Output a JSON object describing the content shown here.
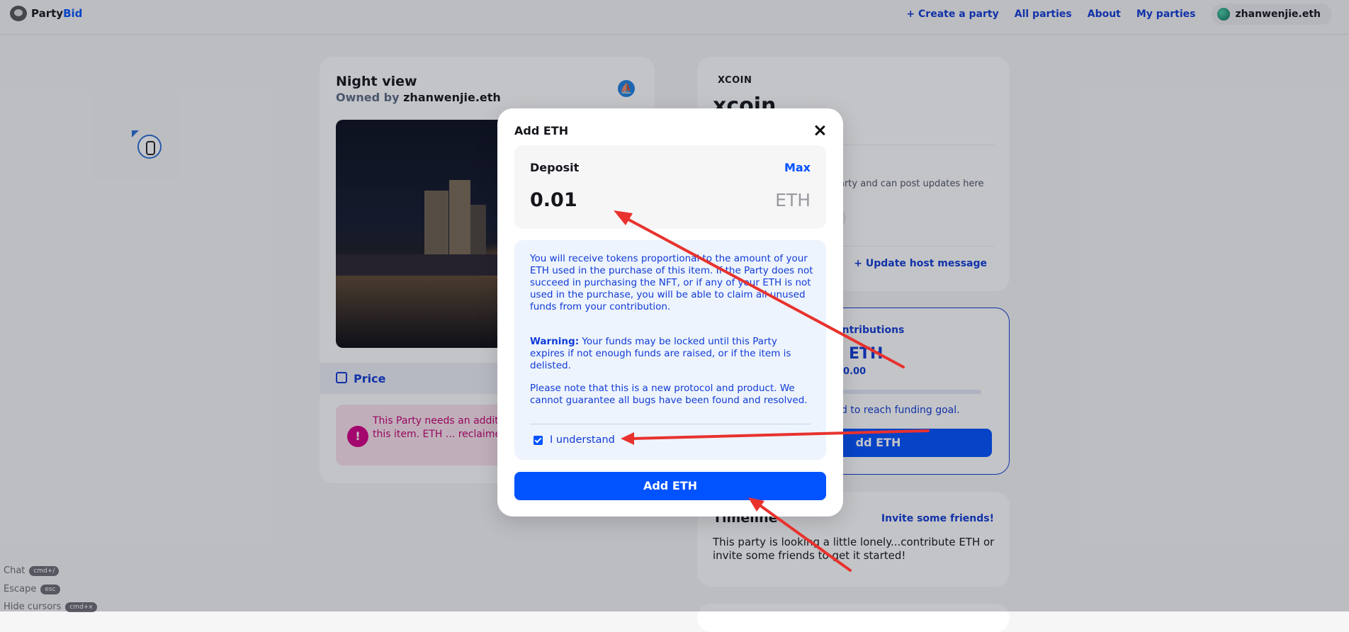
{
  "header": {
    "logo_part1": "Party",
    "logo_part2": "Bid",
    "nav": [
      "+ Create a party",
      "All parties",
      "About",
      "My parties"
    ],
    "account": "zhanwenjie.eth"
  },
  "nft": {
    "title": "Night view",
    "owned_prefix": "Owned by",
    "owner": "zhanwenjie.eth",
    "price_label": "Price",
    "warning_text": "This Party needs an additional ... ETH to purchase this item. ETH ... reclaimed when the party ..."
  },
  "right": {
    "symbol": "XCOIN",
    "name": "xcoin",
    "host_text": "arty and can post updates here",
    "update_link": "+ Update host message",
    "contrib_title": "ontributions",
    "contrib_amount": "0 ETH",
    "contrib_usd": "$0.00",
    "contrib_goal": "red to reach funding goal.",
    "contrib_button": "dd ETH",
    "timeline_title": "Timeline",
    "invite_link": "Invite some friends!",
    "timeline_text": "This party is looking a little lonely...contribute ETH or invite some friends to get it started!"
  },
  "hints": [
    {
      "label": "Chat",
      "key": "cmd+/"
    },
    {
      "label": "Escape",
      "key": "esc"
    },
    {
      "label": "Hide cursors",
      "key": "cmd+x"
    }
  ],
  "modal": {
    "title": "Add ETH",
    "deposit_label": "Deposit",
    "max_label": "Max",
    "amount": "0.01",
    "unit": "ETH",
    "info_p1": "You will receive tokens proportional to the amount of your ETH used in the purchase of this item. If the Party does not succeed in purchasing the NFT, or if any of your ETH is not used in the purchase, you will be able to claim all unused funds from your contribution.",
    "warning_label": "Warning:",
    "warning_text": "Your funds may be locked until this Party expires if not enough funds are raised, or if the item is delisted.",
    "info_p3": "Please note that this is a new protocol and product. We cannot guarantee all bugs have been found and resolved.",
    "understand_label": "I understand",
    "understand_checked": true,
    "submit_label": "Add ETH"
  },
  "colors": {
    "accent": "#0152ff",
    "link": "#0f3bd6",
    "warning": "#c40073",
    "annotation_arrow": "#e8322e"
  }
}
